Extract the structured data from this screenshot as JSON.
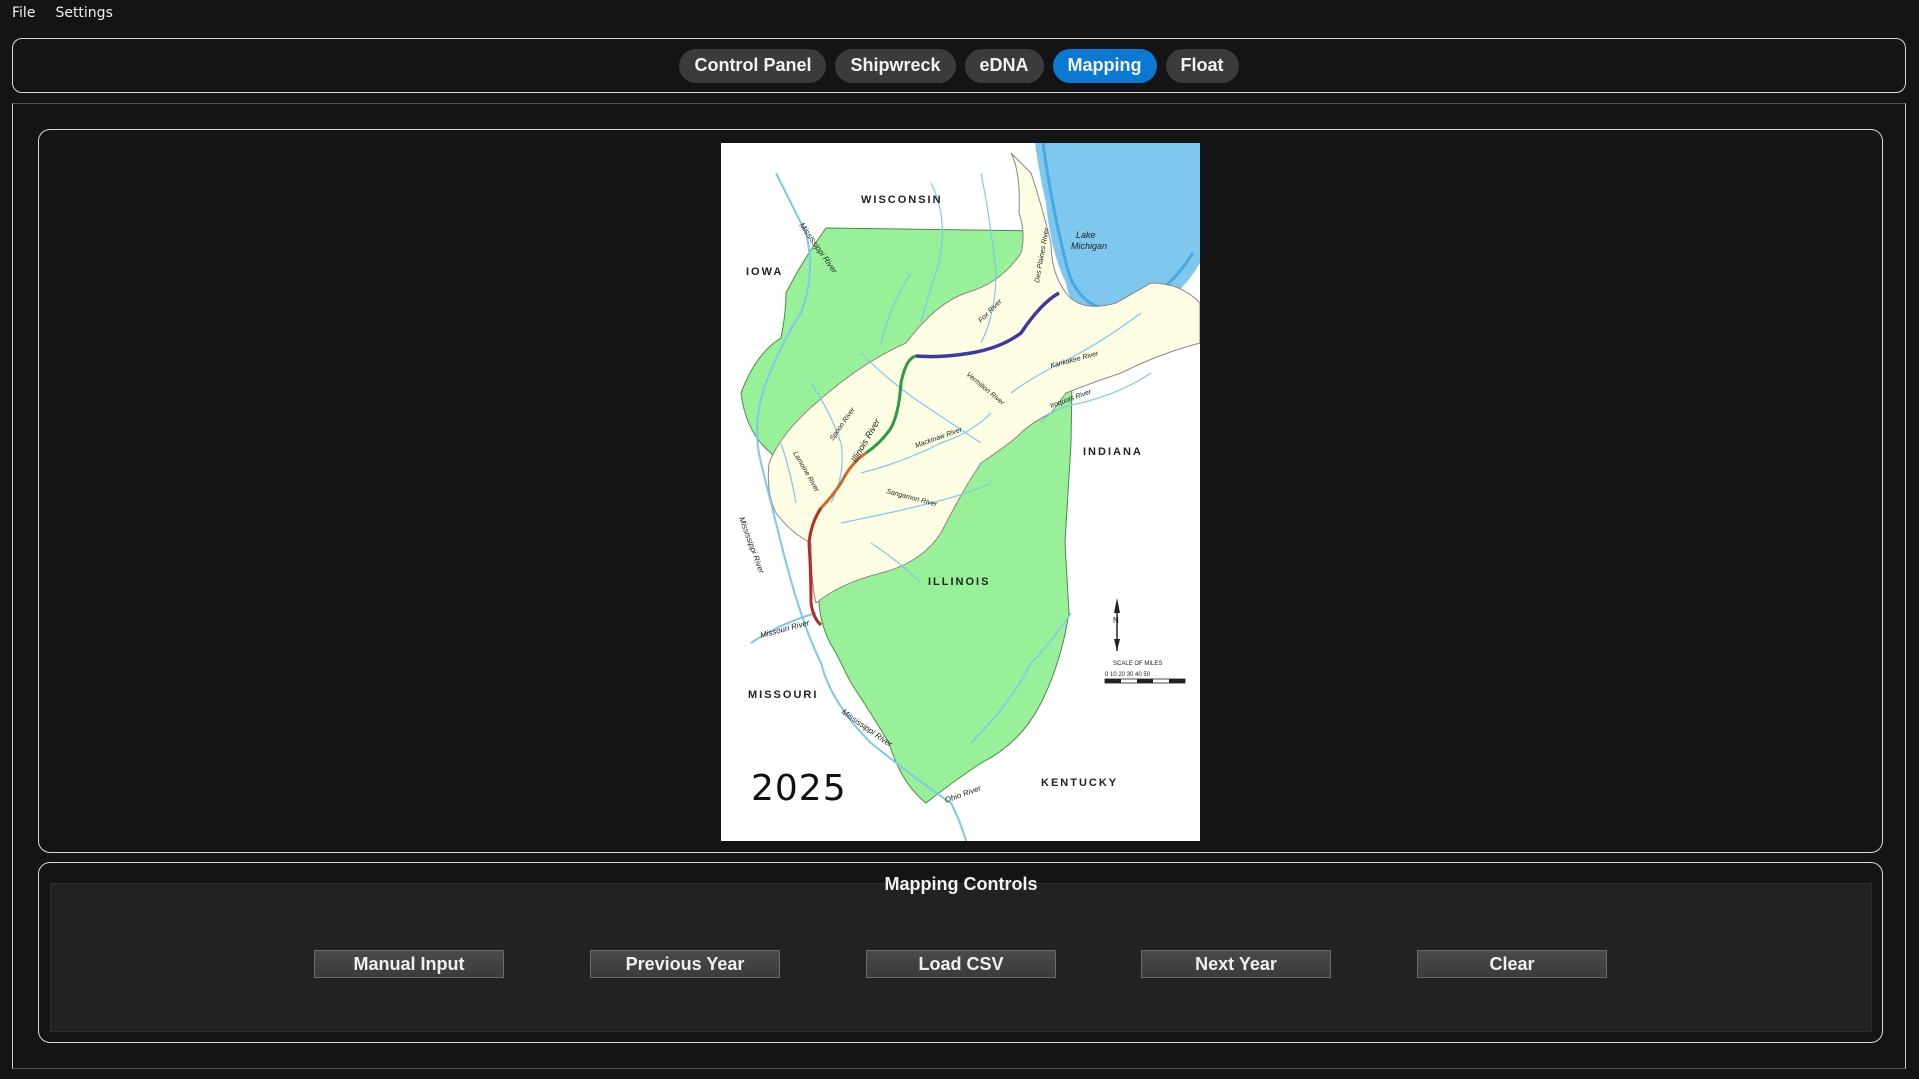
{
  "menu": {
    "file": "File",
    "settings": "Settings"
  },
  "tabs": [
    {
      "label": "Control Panel",
      "active": false
    },
    {
      "label": "Shipwreck",
      "active": false
    },
    {
      "label": "eDNA",
      "active": false
    },
    {
      "label": "Mapping",
      "active": true
    },
    {
      "label": "Float",
      "active": false
    }
  ],
  "map": {
    "year": "2025",
    "labels": {
      "wisconsin": "WISCONSIN",
      "iowa": "IOWA",
      "indiana": "INDIANA",
      "illinois": "ILLINOIS",
      "missouri": "MISSOURI",
      "kentucky": "KENTUCKY",
      "lake_michigan_1": "Lake",
      "lake_michigan_2": "Michigan",
      "mississippi_river_1": "Mississippi River",
      "mississippi_river_2": "Mississippi River",
      "mississippi_river_3": "Mississippi River",
      "missouri_river": "Missouri River",
      "ohio_river": "Ohio River",
      "illinois_river": "Illinois River",
      "fox_river": "Fox River",
      "des_plaines_river": "Des Plaines River",
      "kankakee_river": "Kankakee River",
      "iroquois_river": "Iroquois River",
      "vermilion_river": "Vermilion River",
      "spoon_river": "Spoon River",
      "mackinaw_river": "Mackinaw River",
      "sangamon_river": "Sangamon River",
      "lamoine_river": "Lamoine River",
      "scale_title": "SCALE OF MILES",
      "scale_ticks": "0  10  20  30  40  50",
      "north": "N"
    }
  },
  "controls": {
    "title": "Mapping Controls",
    "buttons": {
      "manual_input": "Manual Input",
      "previous_year": "Previous Year",
      "load_csv": "Load CSV",
      "next_year": "Next Year",
      "clear": "Clear"
    }
  },
  "colors": {
    "accent": "#0b78d1",
    "state_green": "#98f098",
    "basin_fill": "#fdfde4",
    "water": "#7ec8f0",
    "river_segment_blue": "#3a3aa0",
    "river_segment_green": "#2e9a3e",
    "river_segment_orange": "#d06a2a",
    "river_segment_red": "#b82a22"
  }
}
